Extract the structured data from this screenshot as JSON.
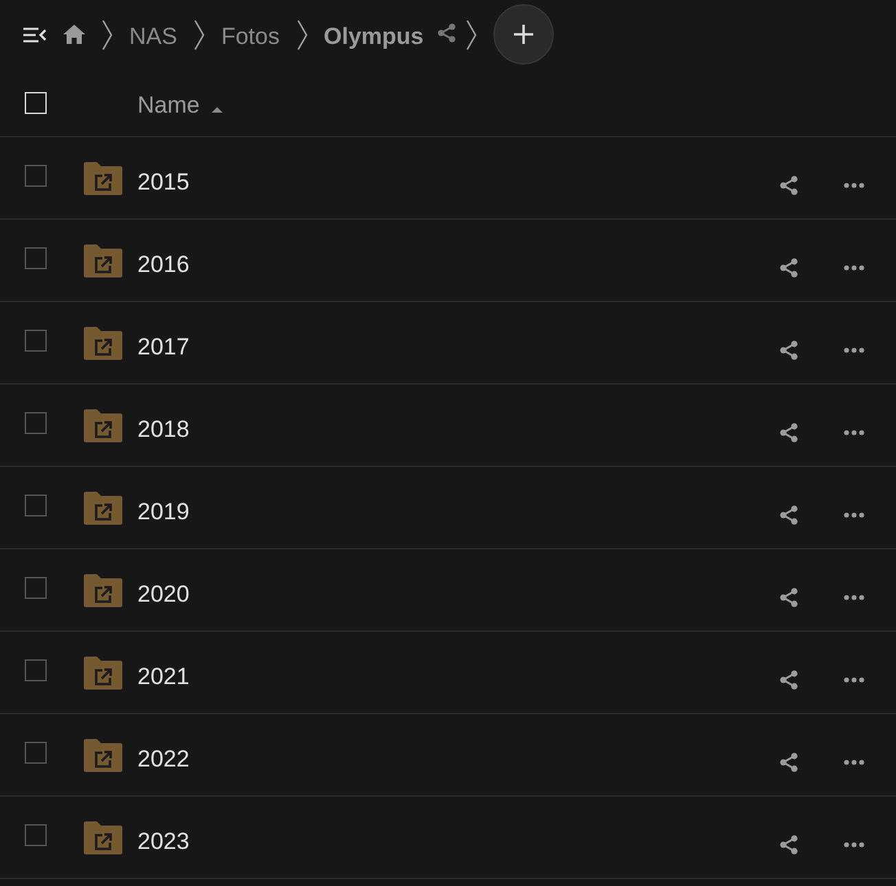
{
  "toolbar": {
    "breadcrumbs": [
      {
        "label": "NAS",
        "current": false
      },
      {
        "label": "Fotos",
        "current": false
      },
      {
        "label": "Olympus",
        "current": true
      }
    ]
  },
  "header": {
    "select_all_checked": false,
    "column": "Name",
    "sort_ascending": true
  },
  "rows": [
    {
      "name": "2015",
      "checked": false
    },
    {
      "name": "2016",
      "checked": false
    },
    {
      "name": "2017",
      "checked": false
    },
    {
      "name": "2018",
      "checked": false
    },
    {
      "name": "2019",
      "checked": false
    },
    {
      "name": "2020",
      "checked": false
    },
    {
      "name": "2021",
      "checked": false
    },
    {
      "name": "2022",
      "checked": false
    },
    {
      "name": "2023",
      "checked": false
    }
  ]
}
